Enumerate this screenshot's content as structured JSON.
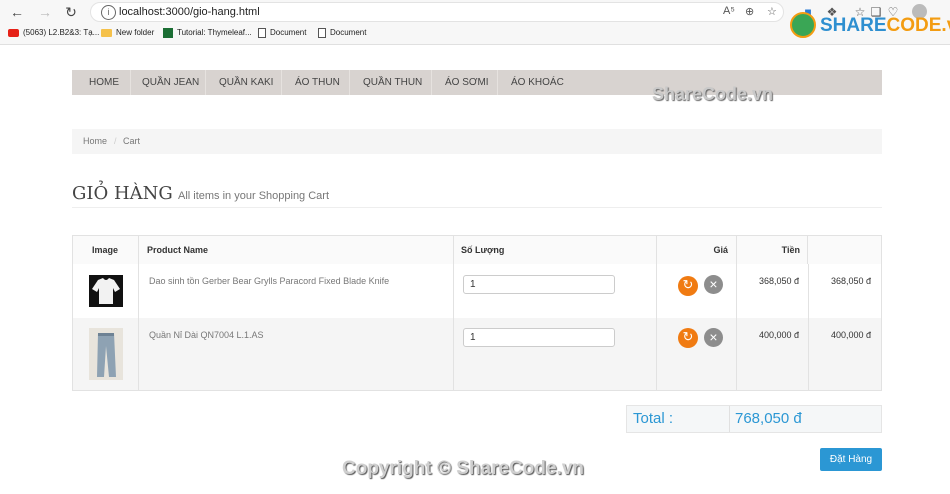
{
  "browser": {
    "url": "localhost:3000/gio-hang.html",
    "bookmarks": [
      {
        "label": "(5063) L2.B2&3: Tạ...",
        "icon": "youtube-icon"
      },
      {
        "label": "New folder",
        "icon": "folder-icon"
      },
      {
        "label": "Tutorial: Thymeleaf...",
        "icon": "thymeleaf-icon"
      },
      {
        "label": "Document",
        "icon": "document-icon"
      },
      {
        "label": "Document",
        "icon": "document-icon"
      }
    ]
  },
  "watermark": {
    "logo_share": "SHARE",
    "logo_code": "CODE.vn",
    "middle": "ShareCode.vn",
    "footer": "Copyright © ShareCode.vn"
  },
  "menu": [
    "HOME",
    "QUẦN JEAN",
    "QUẦN KAKI",
    "ÁO THUN",
    "QUẦN THUN",
    "ÁO SƠMI",
    "ÁO KHOÁC"
  ],
  "breadcrumb": {
    "home": "Home",
    "separator": "/",
    "current": "Cart"
  },
  "page": {
    "title": "GIỎ HÀNG",
    "subtitle": "All items in your Shopping Cart"
  },
  "table": {
    "headers": {
      "image": "Image",
      "product": "Product Name",
      "qty": "Số Lượng",
      "price": "Giá",
      "total": "Tiền"
    },
    "rows": [
      {
        "name": "Dao sinh tồn Gerber Bear Grylls Paracord Fixed Blade Knife",
        "qty": "1",
        "price": "368,050 đ",
        "total": "368,050 đ"
      },
      {
        "name": "Quần Nỉ Dài QN7004 L.1.AS",
        "qty": "1",
        "price": "400,000 đ",
        "total": "400,000 đ"
      }
    ]
  },
  "summary": {
    "total_label": "Total :",
    "total_value": "768,050 đ"
  },
  "checkout_label": "Đặt Hàng",
  "colors": {
    "accent": "#2b97d4",
    "menu_bg": "#d8d3d0",
    "update_btn": "#f07b12",
    "remove_btn": "#8d8d8d"
  }
}
